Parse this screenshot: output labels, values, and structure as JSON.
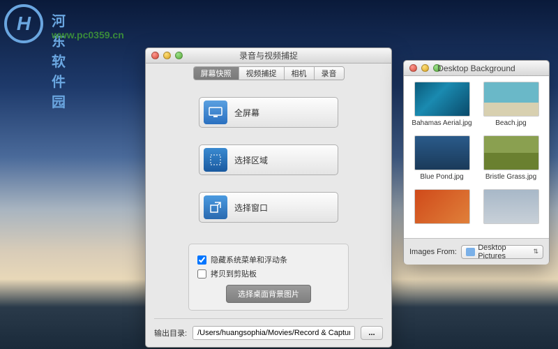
{
  "watermark": {
    "brand": "河东软件园",
    "url": "www.pc0359.cn"
  },
  "mainWin": {
    "title": "录音与视频捕捉",
    "tabs": [
      "屏幕快照",
      "视频捕捉",
      "相机",
      "录音"
    ],
    "activeTab": 0,
    "buttons": {
      "fullscreen": "全屏幕",
      "region": "选择区域",
      "window": "选择窗口"
    },
    "checks": {
      "hideMenu": "隐藏系统菜单和浮动条",
      "hideMenuChecked": true,
      "copyClipboard": "拷贝到剪贴板",
      "copyClipboardChecked": false,
      "bgButton": "选择桌面背景图片"
    },
    "outputLabel": "输出目录:",
    "outputPath": "/Users/huangsophia/Movies/Record & Capture",
    "browse": "..."
  },
  "sideWin": {
    "title": "Desktop Background",
    "thumbs": [
      {
        "name": "Bahamas Aerial.jpg",
        "cls": "t1"
      },
      {
        "name": "Beach.jpg",
        "cls": "t2"
      },
      {
        "name": "Blue Pond.jpg",
        "cls": "t3"
      },
      {
        "name": "Bristle Grass.jpg",
        "cls": "t4"
      },
      {
        "name": "",
        "cls": "t5"
      },
      {
        "name": "",
        "cls": "t6"
      }
    ],
    "footerLabel": "Images From:",
    "folder": "Desktop Pictures"
  }
}
